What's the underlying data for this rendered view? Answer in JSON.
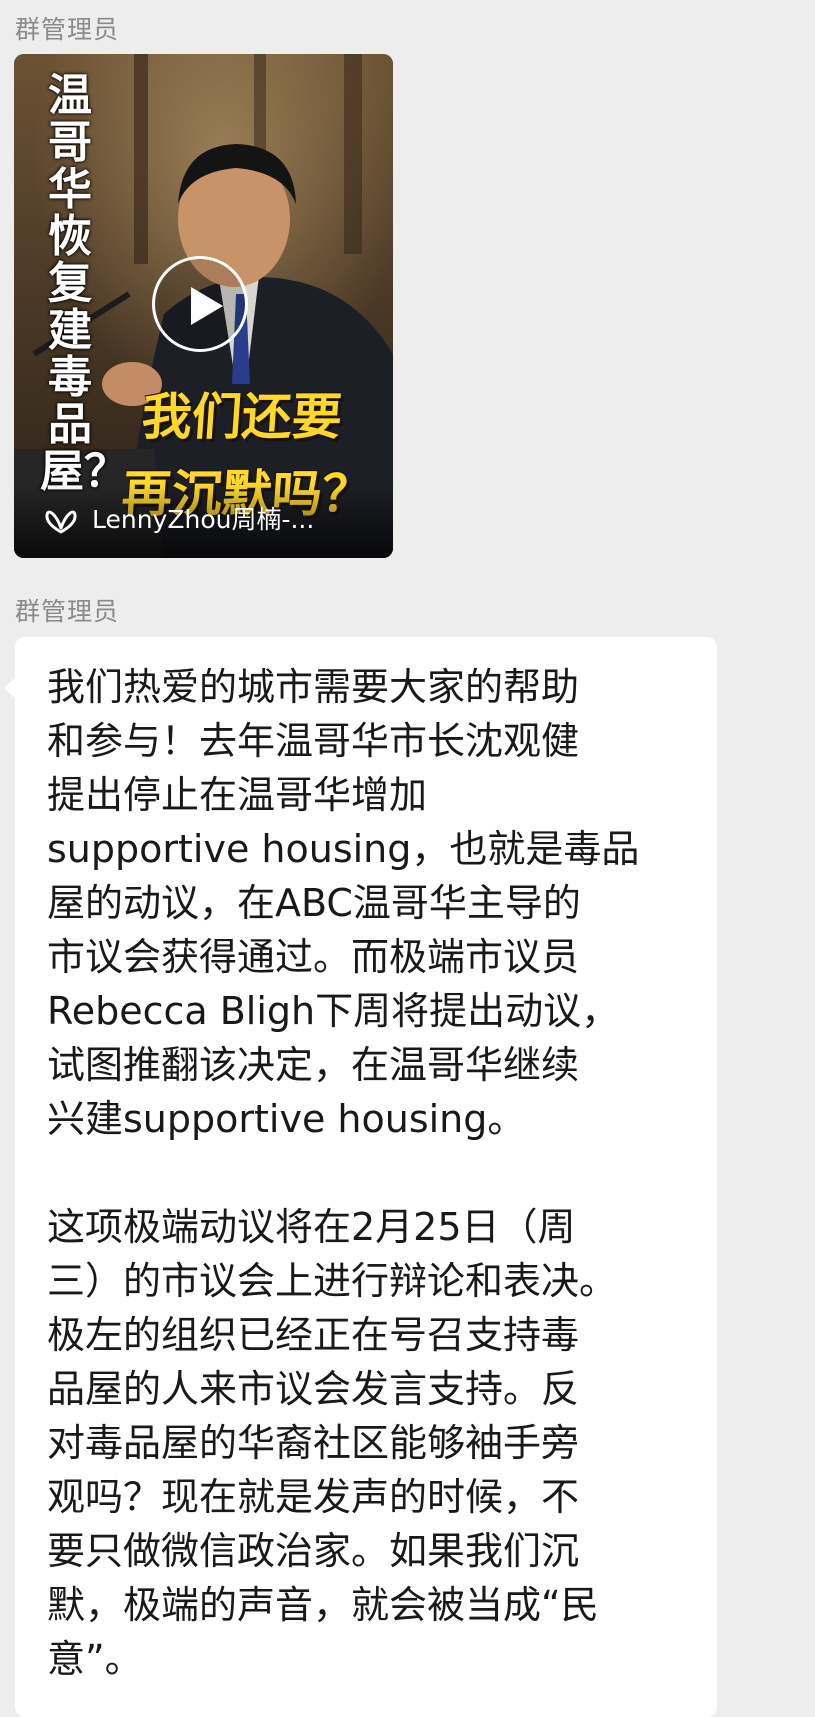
{
  "messages": [
    {
      "sender": "群管理员",
      "type": "video",
      "video": {
        "vertical_title": "温哥华恢复建毒品屋？",
        "headline_line1": "我们还要",
        "headline_line2": "再沉默吗？",
        "channel": "LennyZhou周楠-...",
        "play_icon": "play-circle-icon",
        "channel_icon": "channels-butterfly-icon"
      }
    },
    {
      "sender": "群管理员",
      "type": "text",
      "paragraph1": [
        "我们热爱的城市需要大家的帮助",
        "和参与！去年温哥华市长沈观健",
        "提出停止在温哥华增加",
        "supportive housing，也就是毒品",
        "屋的动议，在ABC温哥华主导的",
        "市议会获得通过。而极端市议员",
        "Rebecca Bligh下周将提出动议，",
        "试图推翻该决定，在温哥华继续",
        "兴建supportive housing。"
      ],
      "paragraph2": [
        "这项极端动议将在2月25日（周",
        "三）的市议会上进行辩论和表决。",
        "极左的组织已经正在号召支持毒",
        "品屋的人来市议会发言支持。反",
        "对毒品屋的华裔社区能够袖手旁",
        "观吗？现在就是发声的时候，不",
        "要只做微信政治家。如果我们沉",
        "默，极端的声音，就会被当成“民",
        "意”。"
      ]
    }
  ],
  "colors": {
    "background": "#ededed",
    "bubble": "#ffffff",
    "sender": "#8a8a8a",
    "text": "#191919",
    "headline": "#ffd82b"
  }
}
